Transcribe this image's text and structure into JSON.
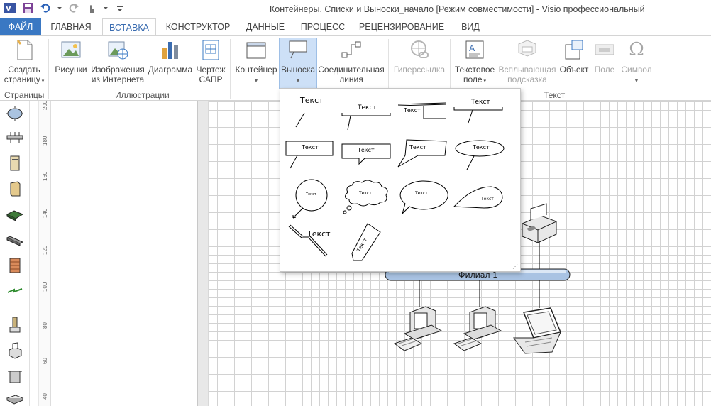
{
  "window": {
    "title": "Контейнеры, Списки и Выноски_начало  [Режим совместимости] -  Visio профессиональный"
  },
  "quick_access": [
    "visio-logo-icon",
    "save-icon",
    "undo-icon",
    "redo-icon",
    "touch-mode-icon",
    "customize-qat-icon"
  ],
  "tabs": {
    "file": "ФАЙЛ",
    "home": "ГЛАВНАЯ",
    "insert": "ВСТАВКА",
    "design": "КОНСТРУКТОР",
    "data": "ДАННЫЕ",
    "process": "ПРОЦЕСС",
    "review": "РЕЦЕНЗИРОВАНИЕ",
    "view": "ВИД",
    "active": "ВСТАВКА"
  },
  "ribbon": {
    "pages": {
      "new_page_l1": "Создать",
      "new_page_l2": "страницу",
      "group": "Страницы"
    },
    "illustrations": {
      "pictures": "Рисунки",
      "online_l1": "Изображения",
      "online_l2": "из Интернета",
      "chart": "Диаграмма",
      "cad_l1": "Чертеж",
      "cad_l2": "САПР",
      "group": "Иллюстрации"
    },
    "diagram_parts": {
      "container": "Контейнер",
      "callout": "Выноска",
      "connector_l1": "Соединительная",
      "connector_l2": "линия"
    },
    "links": {
      "hyperlink": "Гиперссылка"
    },
    "text": {
      "textbox_l1": "Текстовое",
      "textbox_l2": "поле",
      "screentip_l1": "Всплывающая",
      "screentip_l2": "подсказка",
      "object": "Объект",
      "field": "Поле",
      "symbol": "Символ",
      "group": "Текст"
    }
  },
  "callout_gallery": {
    "label": "Текст"
  },
  "ruler": {
    "ticks": [
      "200",
      "180",
      "160",
      "140",
      "120",
      "100",
      "80",
      "60",
      "40"
    ]
  },
  "diagram": {
    "bus_label": "Филиал 1"
  },
  "colors": {
    "file_tab": "#3a78c3",
    "selected": "#cde0f7",
    "bus": "#a9c3e3"
  }
}
